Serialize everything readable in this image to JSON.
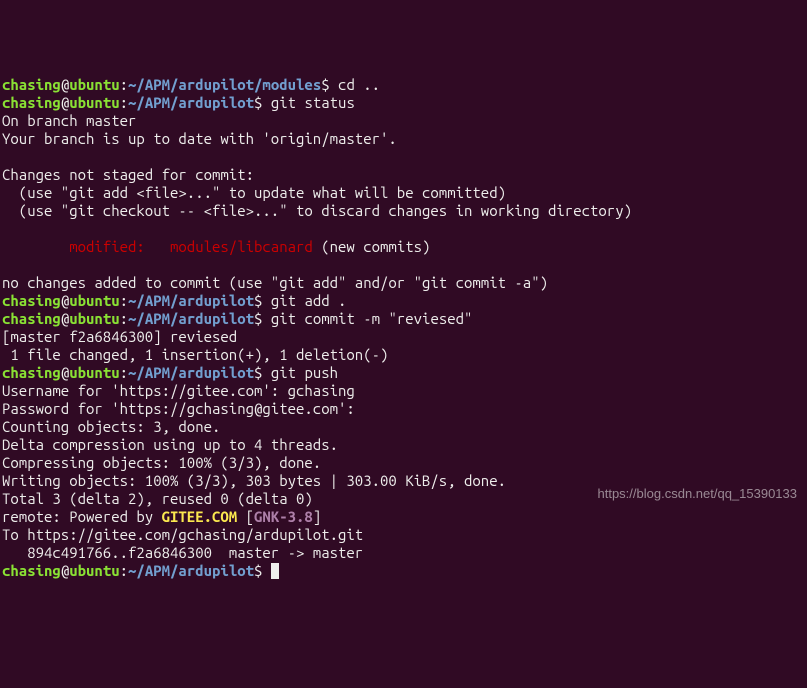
{
  "lines": [
    {
      "segs": [
        {
          "cls": "g",
          "k": "user1"
        },
        {
          "cls": "w",
          "k": "at"
        },
        {
          "cls": "g",
          "k": "host"
        },
        {
          "cls": "w",
          "k": "colon"
        },
        {
          "cls": "b",
          "k": "path_modules"
        },
        {
          "cls": "w",
          "k": "dollar"
        },
        {
          "cls": "w",
          "k": "sp"
        },
        {
          "cls": "w",
          "k": "cmd_cd"
        }
      ]
    },
    {
      "segs": [
        {
          "cls": "g",
          "k": "user1"
        },
        {
          "cls": "w",
          "k": "at"
        },
        {
          "cls": "g",
          "k": "host"
        },
        {
          "cls": "w",
          "k": "colon"
        },
        {
          "cls": "b",
          "k": "path_ardu"
        },
        {
          "cls": "w",
          "k": "dollar"
        },
        {
          "cls": "w",
          "k": "sp"
        },
        {
          "cls": "w",
          "k": "cmd_status"
        }
      ]
    },
    {
      "segs": [
        {
          "cls": "w",
          "k": "s_branch"
        }
      ]
    },
    {
      "segs": [
        {
          "cls": "w",
          "k": "s_uptodate"
        }
      ]
    },
    {
      "segs": []
    },
    {
      "segs": [
        {
          "cls": "w",
          "k": "s_notstaged"
        }
      ]
    },
    {
      "segs": [
        {
          "cls": "w",
          "k": "s_use_add"
        }
      ]
    },
    {
      "segs": [
        {
          "cls": "w",
          "k": "s_use_checkout"
        }
      ]
    },
    {
      "segs": []
    },
    {
      "segs": [
        {
          "cls": "r",
          "k": "s_modified"
        },
        {
          "cls": "w",
          "k": "s_newcommits"
        }
      ]
    },
    {
      "segs": []
    },
    {
      "segs": [
        {
          "cls": "w",
          "k": "s_nochanges"
        }
      ]
    },
    {
      "segs": [
        {
          "cls": "g",
          "k": "user1"
        },
        {
          "cls": "w",
          "k": "at"
        },
        {
          "cls": "g",
          "k": "host"
        },
        {
          "cls": "w",
          "k": "colon"
        },
        {
          "cls": "b",
          "k": "path_ardu"
        },
        {
          "cls": "w",
          "k": "dollar"
        },
        {
          "cls": "w",
          "k": "sp"
        },
        {
          "cls": "w",
          "k": "cmd_add"
        }
      ]
    },
    {
      "segs": [
        {
          "cls": "g",
          "k": "user1"
        },
        {
          "cls": "w",
          "k": "at"
        },
        {
          "cls": "g",
          "k": "host"
        },
        {
          "cls": "w",
          "k": "colon"
        },
        {
          "cls": "b",
          "k": "path_ardu"
        },
        {
          "cls": "w",
          "k": "dollar"
        },
        {
          "cls": "w",
          "k": "sp"
        },
        {
          "cls": "w",
          "k": "cmd_commit"
        }
      ]
    },
    {
      "segs": [
        {
          "cls": "w",
          "k": "c_master"
        }
      ]
    },
    {
      "segs": [
        {
          "cls": "w",
          "k": "c_file"
        }
      ]
    },
    {
      "segs": [
        {
          "cls": "g",
          "k": "user1"
        },
        {
          "cls": "w",
          "k": "at"
        },
        {
          "cls": "g",
          "k": "host"
        },
        {
          "cls": "w",
          "k": "colon"
        },
        {
          "cls": "b",
          "k": "path_ardu"
        },
        {
          "cls": "w",
          "k": "dollar"
        },
        {
          "cls": "w",
          "k": "sp"
        },
        {
          "cls": "w",
          "k": "cmd_push"
        }
      ]
    },
    {
      "segs": [
        {
          "cls": "w",
          "k": "p_user"
        }
      ]
    },
    {
      "segs": [
        {
          "cls": "w",
          "k": "p_pass"
        }
      ]
    },
    {
      "segs": [
        {
          "cls": "w",
          "k": "p_count"
        }
      ]
    },
    {
      "segs": [
        {
          "cls": "w",
          "k": "p_delta"
        }
      ]
    },
    {
      "segs": [
        {
          "cls": "w",
          "k": "p_compress"
        }
      ]
    },
    {
      "segs": [
        {
          "cls": "w",
          "k": "p_write"
        }
      ]
    },
    {
      "segs": [
        {
          "cls": "w",
          "k": "p_total"
        }
      ]
    },
    {
      "segs": [
        {
          "cls": "w",
          "k": "p_remote1"
        },
        {
          "cls": "y",
          "k": "p_gitee"
        },
        {
          "cls": "w",
          "k": "sp"
        },
        {
          "cls": "w",
          "k": "p_lbr"
        },
        {
          "cls": "p",
          "k": "p_gnk"
        },
        {
          "cls": "w",
          "k": "p_rbr"
        }
      ]
    },
    {
      "segs": [
        {
          "cls": "w",
          "k": "p_to"
        }
      ]
    },
    {
      "segs": [
        {
          "cls": "w",
          "k": "p_hashes"
        }
      ]
    },
    {
      "segs": [
        {
          "cls": "g",
          "k": "user1"
        },
        {
          "cls": "w",
          "k": "at"
        },
        {
          "cls": "g",
          "k": "host"
        },
        {
          "cls": "w",
          "k": "colon"
        },
        {
          "cls": "b",
          "k": "path_ardu"
        },
        {
          "cls": "w",
          "k": "dollar"
        },
        {
          "cls": "w",
          "k": "sp"
        }
      ],
      "cursor": true
    }
  ],
  "strings": {
    "user1": "chasing",
    "at": "@",
    "host": "ubuntu",
    "colon": ":",
    "path_modules": "~/APM/ardupilot/modules",
    "path_ardu": "~/APM/ardupilot",
    "dollar": "$",
    "sp": " ",
    "cmd_cd": "cd ..",
    "cmd_status": "git status",
    "s_branch": "On branch master",
    "s_uptodate": "Your branch is up to date with 'origin/master'.",
    "s_notstaged": "Changes not staged for commit:",
    "s_use_add": "  (use \"git add <file>...\" to update what will be committed)",
    "s_use_checkout": "  (use \"git checkout -- <file>...\" to discard changes in working directory)",
    "s_modified": "        modified:   modules/libcanard",
    "s_newcommits": " (new commits)",
    "s_nochanges": "no changes added to commit (use \"git add\" and/or \"git commit -a\")",
    "cmd_add": "git add .",
    "cmd_commit": "git commit -m \"reviesed\"",
    "c_master": "[master f2a6846300] reviesed",
    "c_file": " 1 file changed, 1 insertion(+), 1 deletion(-)",
    "cmd_push": "git push",
    "p_user": "Username for 'https://gitee.com': gchasing",
    "p_pass": "Password for 'https://gchasing@gitee.com': ",
    "p_count": "Counting objects: 3, done.",
    "p_delta": "Delta compression using up to 4 threads.",
    "p_compress": "Compressing objects: 100% (3/3), done.",
    "p_write": "Writing objects: 100% (3/3), 303 bytes | 303.00 KiB/s, done.",
    "p_total": "Total 3 (delta 2), reused 0 (delta 0)",
    "p_remote1": "remote: Powered by ",
    "p_gitee": "GITEE.COM",
    "p_lbr": "[",
    "p_gnk": "GNK-3.8",
    "p_rbr": "]",
    "p_to": "To https://gitee.com/gchasing/ardupilot.git",
    "p_hashes": "   894c491766..f2a6846300  master -> master"
  },
  "watermark": "https://blog.csdn.net/qq_15390133"
}
